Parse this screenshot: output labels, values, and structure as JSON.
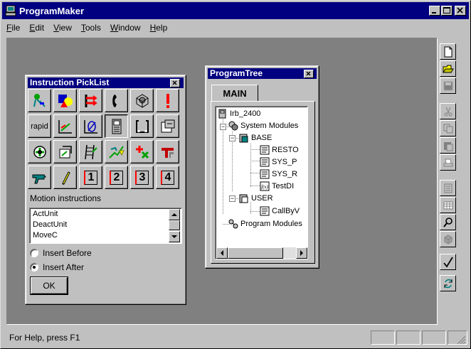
{
  "app": {
    "title": "ProgramMaker",
    "window_buttons": [
      "minimize",
      "maximize",
      "close"
    ]
  },
  "menu": [
    "File",
    "Edit",
    "View",
    "Tools",
    "Window",
    "Help"
  ],
  "toolbar_icons": [
    "new-file-icon",
    "open-folder-icon",
    "save-icon",
    "cut-icon",
    "copy-icon",
    "paste-icon",
    "print-icon",
    "document-icon",
    "table-icon",
    "find-icon",
    "cube-icon",
    "check-icon",
    "sync-icon"
  ],
  "picklist": {
    "title": "Instruction PickList",
    "rows": [
      [
        "tool-data-icon",
        "shapes-icon",
        "branch-icon",
        "phone-icon",
        "gear-box-icon",
        "exclamation-icon"
      ],
      [
        "rapid",
        "axis-icon",
        "zero-icon",
        "cabinet-icon",
        "rotate-icon",
        "mirror-icon"
      ],
      [
        "target-icon",
        "robot-motion-icon",
        "ladder-icon",
        "spark-icon",
        "cross-add-icon",
        "gripper-icon"
      ],
      [
        "drill-icon",
        "pen-icon",
        "1",
        "2",
        "3",
        "4"
      ]
    ],
    "category_label": "Motion instructions",
    "list_items": [
      "ActUnit",
      "DeactUnit",
      "MoveC"
    ],
    "radio_insert_before": "Insert Before",
    "radio_insert_after": "Insert After",
    "selected_radio": "after",
    "ok_label": "OK"
  },
  "tree": {
    "title": "ProgramTree",
    "tab": "MAIN",
    "nodes": {
      "root": "Irb_2400",
      "system_modules": "System Modules",
      "base": "BASE",
      "resto": "RESTO",
      "sys_p": "SYS_P",
      "sys_r": "SYS_R",
      "testdi": "TestDI",
      "user": "USER",
      "callbyv": "CallByV",
      "program_modules": "Program Modules"
    }
  },
  "status": {
    "help_text": "For Help, press F1"
  },
  "colors": {
    "titlebar": "#000080",
    "face": "#c0c0c0",
    "workspace": "#808080"
  }
}
